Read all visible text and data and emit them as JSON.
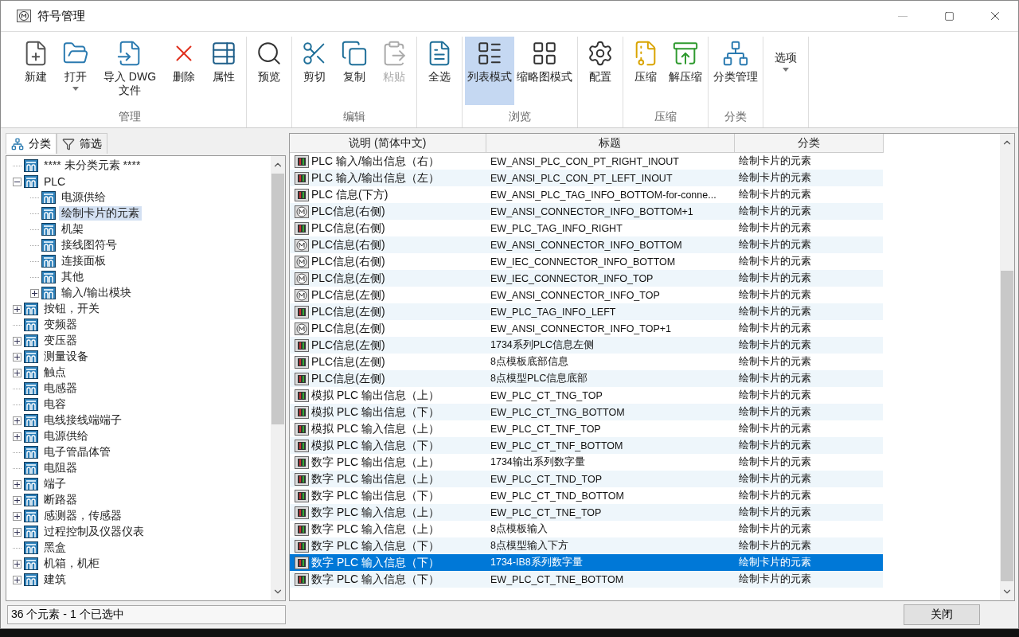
{
  "window": {
    "title": "符号管理"
  },
  "ribbon": {
    "groups": [
      {
        "label": "管理",
        "buttons": [
          {
            "kind": "new",
            "label": "新建",
            "disabled": false,
            "selected": false,
            "dropdown": false
          },
          {
            "kind": "open",
            "label": "打开",
            "disabled": false,
            "selected": false,
            "dropdown": true
          },
          {
            "kind": "import",
            "label": "导入 DWG 文件",
            "disabled": false,
            "selected": false,
            "dropdown": false
          },
          {
            "kind": "delete",
            "label": "删除",
            "disabled": false,
            "selected": false,
            "dropdown": false
          },
          {
            "kind": "properties",
            "label": "属性",
            "disabled": false,
            "selected": false,
            "dropdown": false
          }
        ]
      },
      {
        "buttons": [
          {
            "kind": "preview",
            "label": "预览",
            "disabled": false,
            "selected": false,
            "dropdown": false
          }
        ]
      },
      {
        "label": "编辑",
        "buttons": [
          {
            "kind": "cut",
            "label": "剪切",
            "disabled": false,
            "selected": false,
            "dropdown": false
          },
          {
            "kind": "copy",
            "label": "复制",
            "disabled": false,
            "selected": false,
            "dropdown": false
          },
          {
            "kind": "paste",
            "label": "粘贴",
            "disabled": true,
            "selected": false,
            "dropdown": false
          }
        ]
      },
      {
        "buttons": [
          {
            "kind": "select_all",
            "label": "全选",
            "disabled": false,
            "selected": false,
            "dropdown": false
          }
        ]
      },
      {
        "label": "浏览",
        "buttons": [
          {
            "kind": "list",
            "label": "列表模式",
            "disabled": false,
            "selected": true,
            "dropdown": false
          },
          {
            "kind": "thumbs",
            "label": "缩略图模式",
            "disabled": false,
            "selected": false,
            "dropdown": false
          }
        ]
      },
      {
        "buttons": [
          {
            "kind": "config",
            "label": "配置",
            "disabled": false,
            "selected": false,
            "dropdown": false
          }
        ]
      },
      {
        "label": "压缩",
        "buttons": [
          {
            "kind": "compress",
            "label": "压缩",
            "disabled": false,
            "selected": false,
            "dropdown": false
          },
          {
            "kind": "extract",
            "label": "解压缩",
            "disabled": false,
            "selected": false,
            "dropdown": false
          }
        ]
      },
      {
        "label": "分类",
        "buttons": [
          {
            "kind": "category",
            "label": "分类管理",
            "disabled": false,
            "selected": false,
            "dropdown": false
          }
        ]
      },
      {
        "buttons": [
          {
            "kind": "text",
            "label": "选项",
            "disabled": false,
            "selected": false,
            "dropdown": true
          }
        ]
      }
    ]
  },
  "panel_tabs": [
    {
      "kind": "category",
      "label": "分类",
      "selected": true
    },
    {
      "kind": "filter",
      "label": "筛选",
      "selected": false
    }
  ],
  "tree": [
    {
      "label": "**** 未分类元素 ****",
      "selected": false
    },
    {
      "label": "PLC",
      "selected": false,
      "expanded": true,
      "children": [
        {
          "label": "电源供给",
          "selected": false
        },
        {
          "label": "绘制卡片的元素",
          "selected": true
        },
        {
          "label": "机架",
          "selected": false
        },
        {
          "label": "接线图符号",
          "selected": false
        },
        {
          "label": "连接面板",
          "selected": false
        },
        {
          "label": "其他",
          "selected": false
        },
        {
          "label": "输入/输出模块",
          "selected": false,
          "expanded": false
        }
      ]
    },
    {
      "label": "按钮，开关",
      "selected": false,
      "expanded": false
    },
    {
      "label": "变频器",
      "selected": false
    },
    {
      "label": "变压器",
      "selected": false,
      "expanded": false
    },
    {
      "label": "测量设备",
      "selected": false,
      "expanded": false
    },
    {
      "label": "触点",
      "selected": false,
      "expanded": false
    },
    {
      "label": "电感器",
      "selected": false
    },
    {
      "label": "电容",
      "selected": false
    },
    {
      "label": "电线接线端端子",
      "selected": false,
      "expanded": false
    },
    {
      "label": "电源供给",
      "selected": false,
      "expanded": false
    },
    {
      "label": "电子管晶体管",
      "selected": false
    },
    {
      "label": "电阻器",
      "selected": false
    },
    {
      "label": "端子",
      "selected": false,
      "expanded": false
    },
    {
      "label": "断路器",
      "selected": false,
      "expanded": false
    },
    {
      "label": "感测器，传感器",
      "selected": false,
      "expanded": false
    },
    {
      "label": "过程控制及仪器仪表",
      "selected": false,
      "expanded": false
    },
    {
      "label": "黑盒",
      "selected": false
    },
    {
      "label": "机箱，机柜",
      "selected": false,
      "expanded": false
    },
    {
      "label": "建筑",
      "selected": false,
      "expanded": false
    }
  ],
  "table": {
    "columns": [
      "说明 (简体中文)",
      "标题",
      "分类"
    ],
    "rows": [
      {
        "kind": "symbol",
        "description": "PLC 输入/输出信息（右）",
        "title": "EW_ANSI_PLC_CON_PT_RIGHT_INOUT",
        "category": "绘制卡片的元素",
        "selected": false
      },
      {
        "kind": "symbol",
        "description": "PLC 输入/输出信息（左）",
        "title": "EW_ANSI_PLC_CON_PT_LEFT_INOUT",
        "category": "绘制卡片的元素",
        "selected": false
      },
      {
        "kind": "symbol",
        "description": "PLC 信息(下方)",
        "title": "EW_ANSI_PLC_TAG_INFO_BOTTOM-for-conne...",
        "category": "绘制卡片的元素",
        "selected": false
      },
      {
        "kind": "macro",
        "description": "PLC信息(右侧)",
        "title": "EW_ANSI_CONNECTOR_INFO_BOTTOM+1",
        "category": "绘制卡片的元素",
        "selected": false
      },
      {
        "kind": "symbol",
        "description": "PLC信息(右侧)",
        "title": "EW_PLC_TAG_INFO_RIGHT",
        "category": "绘制卡片的元素",
        "selected": false
      },
      {
        "kind": "macro",
        "description": "PLC信息(右侧)",
        "title": "EW_ANSI_CONNECTOR_INFO_BOTTOM",
        "category": "绘制卡片的元素",
        "selected": false
      },
      {
        "kind": "macro",
        "description": "PLC信息(右侧)",
        "title": "EW_IEC_CONNECTOR_INFO_BOTTOM",
        "category": "绘制卡片的元素",
        "selected": false
      },
      {
        "kind": "macro",
        "description": "PLC信息(左侧)",
        "title": "EW_IEC_CONNECTOR_INFO_TOP",
        "category": "绘制卡片的元素",
        "selected": false
      },
      {
        "kind": "macro",
        "description": "PLC信息(左侧)",
        "title": "EW_ANSI_CONNECTOR_INFO_TOP",
        "category": "绘制卡片的元素",
        "selected": false
      },
      {
        "kind": "symbol",
        "description": "PLC信息(左侧)",
        "title": "EW_PLC_TAG_INFO_LEFT",
        "category": "绘制卡片的元素",
        "selected": false
      },
      {
        "kind": "macro",
        "description": "PLC信息(左侧)",
        "title": "EW_ANSI_CONNECTOR_INFO_TOP+1",
        "category": "绘制卡片的元素",
        "selected": false
      },
      {
        "kind": "symbol",
        "description": "PLC信息(左侧)",
        "title": "1734系列PLC信息左侧",
        "category": "绘制卡片的元素",
        "selected": false
      },
      {
        "kind": "symbol",
        "description": "PLC信息(左侧)",
        "title": "8点模板底部信息",
        "category": "绘制卡片的元素",
        "selected": false
      },
      {
        "kind": "symbol",
        "description": "PLC信息(左侧)",
        "title": "8点模型PLC信息底部",
        "category": "绘制卡片的元素",
        "selected": false
      },
      {
        "kind": "symbol",
        "description": "模拟 PLC 输出信息（上）",
        "title": "EW_PLC_CT_TNG_TOP",
        "category": "绘制卡片的元素",
        "selected": false
      },
      {
        "kind": "symbol",
        "description": "模拟 PLC 输出信息（下）",
        "title": "EW_PLC_CT_TNG_BOTTOM",
        "category": "绘制卡片的元素",
        "selected": false
      },
      {
        "kind": "symbol",
        "description": "模拟 PLC 输入信息（上）",
        "title": "EW_PLC_CT_TNF_TOP",
        "category": "绘制卡片的元素",
        "selected": false
      },
      {
        "kind": "symbol",
        "description": "模拟 PLC 输入信息（下）",
        "title": "EW_PLC_CT_TNF_BOTTOM",
        "category": "绘制卡片的元素",
        "selected": false
      },
      {
        "kind": "symbol",
        "description": "数字 PLC 输出信息（上）",
        "title": "1734输出系列数字量",
        "category": "绘制卡片的元素",
        "selected": false
      },
      {
        "kind": "symbol",
        "description": "数字 PLC 输出信息（上）",
        "title": "EW_PLC_CT_TND_TOP",
        "category": "绘制卡片的元素",
        "selected": false
      },
      {
        "kind": "symbol",
        "description": "数字 PLC 输出信息（下）",
        "title": "EW_PLC_CT_TND_BOTTOM",
        "category": "绘制卡片的元素",
        "selected": false
      },
      {
        "kind": "symbol",
        "description": "数字 PLC 输入信息（上）",
        "title": "EW_PLC_CT_TNE_TOP",
        "category": "绘制卡片的元素",
        "selected": false
      },
      {
        "kind": "symbol",
        "description": "数字 PLC 输入信息（上）",
        "title": "8点模板输入",
        "category": "绘制卡片的元素",
        "selected": false
      },
      {
        "kind": "symbol",
        "description": "数字 PLC 输入信息（下）",
        "title": "8点模型输入下方",
        "category": "绘制卡片的元素",
        "selected": false
      },
      {
        "kind": "symbol",
        "description": "数字 PLC 输入信息（下）",
        "title": "1734-IB8系列数字量",
        "category": "绘制卡片的元素",
        "selected": true
      },
      {
        "kind": "symbol",
        "description": "数字 PLC 输入信息（下）",
        "title": "EW_PLC_CT_TNE_BOTTOM",
        "category": "绘制卡片的元素",
        "selected": false
      }
    ]
  },
  "status_bar": {
    "text": "36 个元素 - 1 个已选中"
  },
  "buttons": [
    "关闭"
  ]
}
